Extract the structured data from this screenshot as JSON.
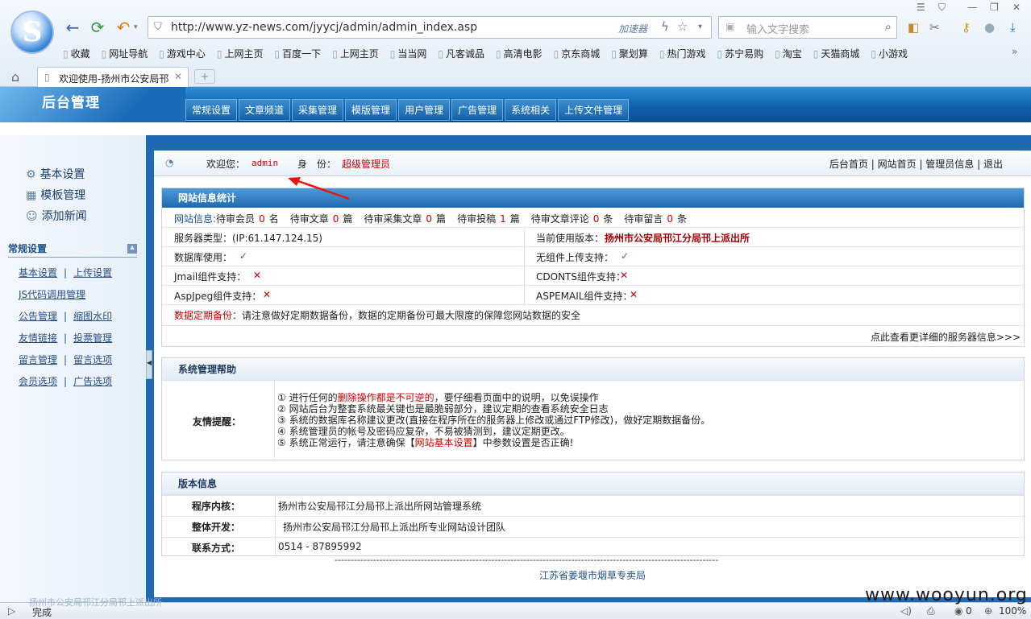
{
  "browser": {
    "url": "http://www.yz-news.com/jyycj/admin/admin_index.asp",
    "accelerator": "加速器",
    "search_placeholder": "输入文字搜索",
    "bookmarks": [
      "收藏",
      "网址导航",
      "游戏中心",
      "上网主页",
      "百度一下",
      "上网主页",
      "当当网",
      "凡客诚品",
      "高清电影",
      "京东商城",
      "聚划算",
      "热门游戏",
      "苏宁易购",
      "淘宝",
      "天猫商城",
      "小游戏"
    ],
    "more": "»",
    "tab_title": "欢迎使用-扬州市公安局邗",
    "new_tab": "+"
  },
  "admin": {
    "title": "后台管理",
    "menu": [
      "常规设置",
      "文章频道",
      "采集管理",
      "模版管理",
      "用户管理",
      "广告管理",
      "系统相关",
      "上传文件管理"
    ]
  },
  "sidebar": {
    "big_items": [
      {
        "label": "基本设置",
        "icon": "gear-icon",
        "glyph": "⚙"
      },
      {
        "label": "模板管理",
        "icon": "template-icon",
        "glyph": "▦"
      },
      {
        "label": "添加新闻",
        "icon": "user-add-icon",
        "glyph": "☺"
      }
    ],
    "section_title": "常规设置",
    "collapse": "▴",
    "links": [
      [
        "基本设置",
        "上传设置"
      ],
      [
        "JS代码调用管理"
      ],
      [
        "公告管理",
        "缩图水印"
      ],
      [
        "友情链接",
        "投票管理"
      ],
      [
        "留言管理",
        "留言选项"
      ],
      [
        "会员选项",
        "广告选项"
      ]
    ]
  },
  "welcome": {
    "label": "欢迎您：",
    "user": "admin",
    "role_label": "身　份：",
    "role": "超级管理员",
    "links": [
      "后台首页",
      "网站首页",
      "管理员信息",
      "退出"
    ]
  },
  "stats": {
    "title": "网站信息统计",
    "info_label": "网站信息:",
    "items": [
      {
        "label": "待审会员",
        "count": "0",
        "unit": "名"
      },
      {
        "label": "待审文章",
        "count": "0",
        "unit": "篇"
      },
      {
        "label": "待审采集文章",
        "count": "0",
        "unit": "篇"
      },
      {
        "label": "待审投稿",
        "count": "1",
        "unit": "篇"
      },
      {
        "label": "待审文章评论",
        "count": "0",
        "unit": "条"
      },
      {
        "label": "待审留言",
        "count": "0",
        "unit": "条"
      }
    ],
    "server_type": "服务器类型：(IP:61.147.124.15)",
    "version_label": "当前使用版本：",
    "version": "扬州市公安局邗江分局邗上派出所",
    "db": "数据库使用：",
    "no_component": "无组件上传支持：",
    "jmail": "Jmail组件支持：",
    "cdonts": "CDONTS组件支持：",
    "aspjpeg": "AspJpeg组件支持：",
    "aspemail": "ASPEMAIL组件支持：",
    "check": "✓",
    "cross": "✕",
    "backup_label": "数据定期备份：",
    "backup_text": "请注意做好定期数据备份，数据的定期备份可最大限度的保障您网站数据的安全",
    "more_link": "点此查看更详细的服务器信息>>>"
  },
  "help": {
    "title": "系统管理帮助",
    "label": "友情提醒：",
    "l1a": "① 进行任何的",
    "l1b": "删除操作都是不可逆的",
    "l1c": "，要仔细看页面中的说明，以免误操作",
    "l2": "② 网站后台为整套系统最关键也是最脆弱部分，建议定期的查看系统安全日志",
    "l3": "③ 系统的数据库名称建议更改(直接在程序所在的服务器上修改或通过FTP修改)，做好定期数据备份。",
    "l4": "④ 系统管理员的帐号及密码应复杂，不易被猜测到，建议定期更改。",
    "l5a": "⑤ 系统正常运行，请注意确保【",
    "l5b": "网站基本设置",
    "l5c": "】中参数设置是否正确!"
  },
  "version": {
    "title": "版本信息",
    "rows": [
      {
        "label": "程序内核：",
        "value": "扬州市公安局邗江分局邗上派出所网站管理系统"
      },
      {
        "label": "整体开发：",
        "value": "扬州市公安局邗江分局邗上派出所专业网站设计团队"
      },
      {
        "label": "联系方式：",
        "value": "0514 - 87895992"
      }
    ],
    "divider": "------------------------------------------------------------------------------------------------------------------------",
    "footer": "江苏省姜堰市烟草专卖局"
  },
  "statusbar": {
    "status": "完成",
    "behind": "扬州市公安局邗江分局邗上派出所",
    "zero": "0",
    "zoom": "100%"
  },
  "watermark": "www.wooyun.org",
  "colors": {
    "accent": "#1e6bb3",
    "red": "#cc0000",
    "check": "#2a8a2a"
  }
}
